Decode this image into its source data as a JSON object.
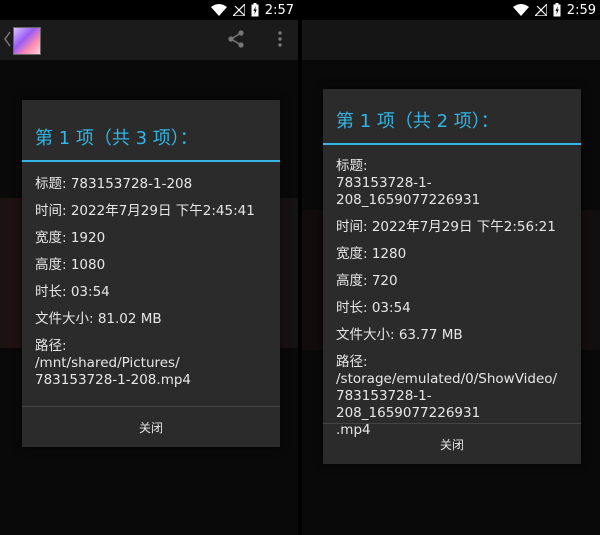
{
  "left_screen": {
    "status": {
      "time": "2:57"
    },
    "dialog": {
      "title": "第 1 项（共 3 项）：",
      "fields": [
        "标题: 783153728-1-208",
        "时间: 2022年7月29日 下午2:45:41",
        "宽度: 1920",
        "高度: 1080",
        "时长: 03:54",
        "文件大小: 81.02 MB",
        "路径:\n/mnt/shared/Pictures/\n783153728-1-208.mp4"
      ],
      "close_label": "关闭"
    }
  },
  "right_screen": {
    "status": {
      "time": "2:59"
    },
    "dialog": {
      "title": "第 1 项（共 2 项）：",
      "fields": [
        "标题:\n783153728-1-208_1659077226931",
        "时间: 2022年7月29日 下午2:56:21",
        "宽度: 1280",
        "高度: 720",
        "时长: 03:54",
        "文件大小: 63.77 MB",
        "路径:\n/storage/emulated/0/ShowVideo/\n783153728-1-208_1659077226931\n.mp4"
      ],
      "close_label": "关闭"
    }
  },
  "icons": {
    "wifi": "wifi-icon",
    "no_signal": "no-signal-icon",
    "battery": "battery-icon",
    "share": "share-icon",
    "more": "more-vert-icon",
    "back": "chevron-left-icon"
  },
  "colors": {
    "accent": "#33b5e5",
    "dialog_bg": "#2b2b2b"
  }
}
